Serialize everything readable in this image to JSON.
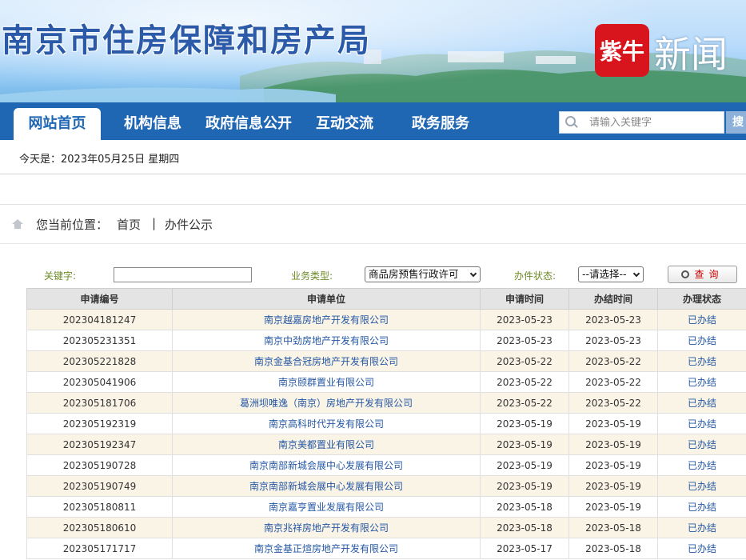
{
  "header": {
    "site_title": "南京市住房保障和房产局",
    "logo_mark": "紫牛",
    "logo_text": "新闻"
  },
  "nav": {
    "items": [
      {
        "label": "网站首页",
        "active": true
      },
      {
        "label": "机构信息",
        "active": false
      },
      {
        "label": "政府信息公开",
        "active": false
      },
      {
        "label": "互动交流",
        "active": false
      },
      {
        "label": "政务服务",
        "active": false
      }
    ],
    "search_placeholder": "请输入关键字",
    "search_button": "搜"
  },
  "date_bar": {
    "text": "今天是：2023年05月25日 星期四"
  },
  "breadcrumb": {
    "prefix": "您当前位置：",
    "home": "首页",
    "separator": "|",
    "current": "办件公示"
  },
  "filters": {
    "keyword_label": "关键字:",
    "keyword_value": "",
    "type_label": "业务类型:",
    "type_value": "商品房预售行政许可",
    "status_label": "办件状态:",
    "status_value": "--请选择--",
    "query_button": "查询"
  },
  "table": {
    "columns": [
      "申请编号",
      "申请单位",
      "申请时间",
      "办结时间",
      "办理状态"
    ],
    "rows": [
      {
        "id": "202304181247",
        "unit": "南京越嘉房地产开发有限公司",
        "apply": "2023-05-23",
        "done": "2023-05-23",
        "status": "已办结"
      },
      {
        "id": "202305231351",
        "unit": "南京中劲房地产开发有限公司",
        "apply": "2023-05-23",
        "done": "2023-05-23",
        "status": "已办结"
      },
      {
        "id": "202305221828",
        "unit": "南京金基合冠房地产开发有限公司",
        "apply": "2023-05-22",
        "done": "2023-05-22",
        "status": "已办结"
      },
      {
        "id": "202305041906",
        "unit": "南京颐群置业有限公司",
        "apply": "2023-05-22",
        "done": "2023-05-22",
        "status": "已办结"
      },
      {
        "id": "202305181706",
        "unit": "葛洲坝唯逸（南京）房地产开发有限公司",
        "apply": "2023-05-22",
        "done": "2023-05-22",
        "status": "已办结"
      },
      {
        "id": "202305192319",
        "unit": "南京高科时代开发有限公司",
        "apply": "2023-05-19",
        "done": "2023-05-19",
        "status": "已办结"
      },
      {
        "id": "202305192347",
        "unit": "南京美都置业有限公司",
        "apply": "2023-05-19",
        "done": "2023-05-19",
        "status": "已办结"
      },
      {
        "id": "202305190728",
        "unit": "南京南部新城会展中心发展有限公司",
        "apply": "2023-05-19",
        "done": "2023-05-19",
        "status": "已办结"
      },
      {
        "id": "202305190749",
        "unit": "南京南部新城会展中心发展有限公司",
        "apply": "2023-05-19",
        "done": "2023-05-19",
        "status": "已办结"
      },
      {
        "id": "202305180811",
        "unit": "南京嘉亨置业发展有限公司",
        "apply": "2023-05-18",
        "done": "2023-05-19",
        "status": "已办结"
      },
      {
        "id": "202305180610",
        "unit": "南京兆祥房地产开发有限公司",
        "apply": "2023-05-18",
        "done": "2023-05-18",
        "status": "已办结"
      },
      {
        "id": "202305171717",
        "unit": "南京金基正煊房地产开发有限公司",
        "apply": "2023-05-17",
        "done": "2023-05-18",
        "status": "已办结"
      }
    ]
  },
  "colors": {
    "nav_bg": "#1f66b3",
    "title_blue": "#2b5aa8",
    "link_blue": "#2457a5",
    "row_alt": "#faf4e6",
    "logo_red": "#d8151d"
  }
}
